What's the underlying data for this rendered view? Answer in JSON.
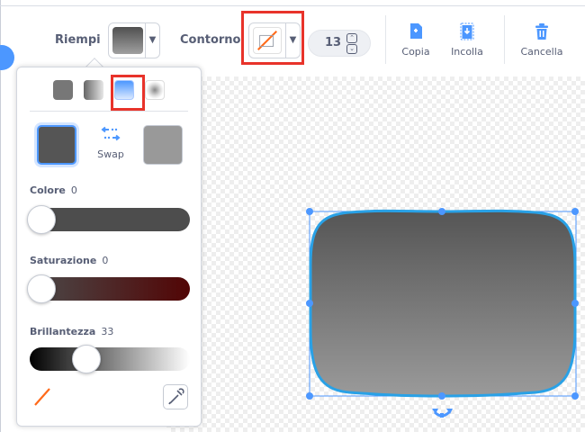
{
  "toolbar": {
    "fill_label": "Riempi",
    "outline_label": "Contorno",
    "outline_width": "13",
    "actions": [
      {
        "label": "Copia",
        "icon": "copy-icon"
      },
      {
        "label": "Incolla",
        "icon": "paste-icon"
      },
      {
        "label": "Cancella",
        "icon": "trash-icon"
      }
    ]
  },
  "fill_popover": {
    "gradient_types": [
      "solid-fill-icon",
      "horizontal-gradient-icon",
      "vertical-gradient-icon",
      "radial-gradient-icon"
    ],
    "selected_gradient": "vertical-gradient-icon",
    "swap_label": "Swap",
    "sliders": [
      {
        "label": "Colore",
        "value": "0",
        "fraction": 0
      },
      {
        "label": "Saturazione",
        "value": "0",
        "fraction": 0
      },
      {
        "label": "Brillantezza",
        "value": "33",
        "fraction": 0.33
      }
    ],
    "no_fill_icon": "no-color-icon",
    "eyedropper_icon": "eyedropper-icon"
  },
  "colors": {
    "accent_blue": "#4c97ff",
    "selection_blue": "#1e90ff",
    "highlight_red": "#e8332a",
    "shape_top": "#555555",
    "shape_bottom": "#9a9a9a",
    "primary_swatch": "#555555",
    "secondary_swatch": "#9a9a9a"
  }
}
